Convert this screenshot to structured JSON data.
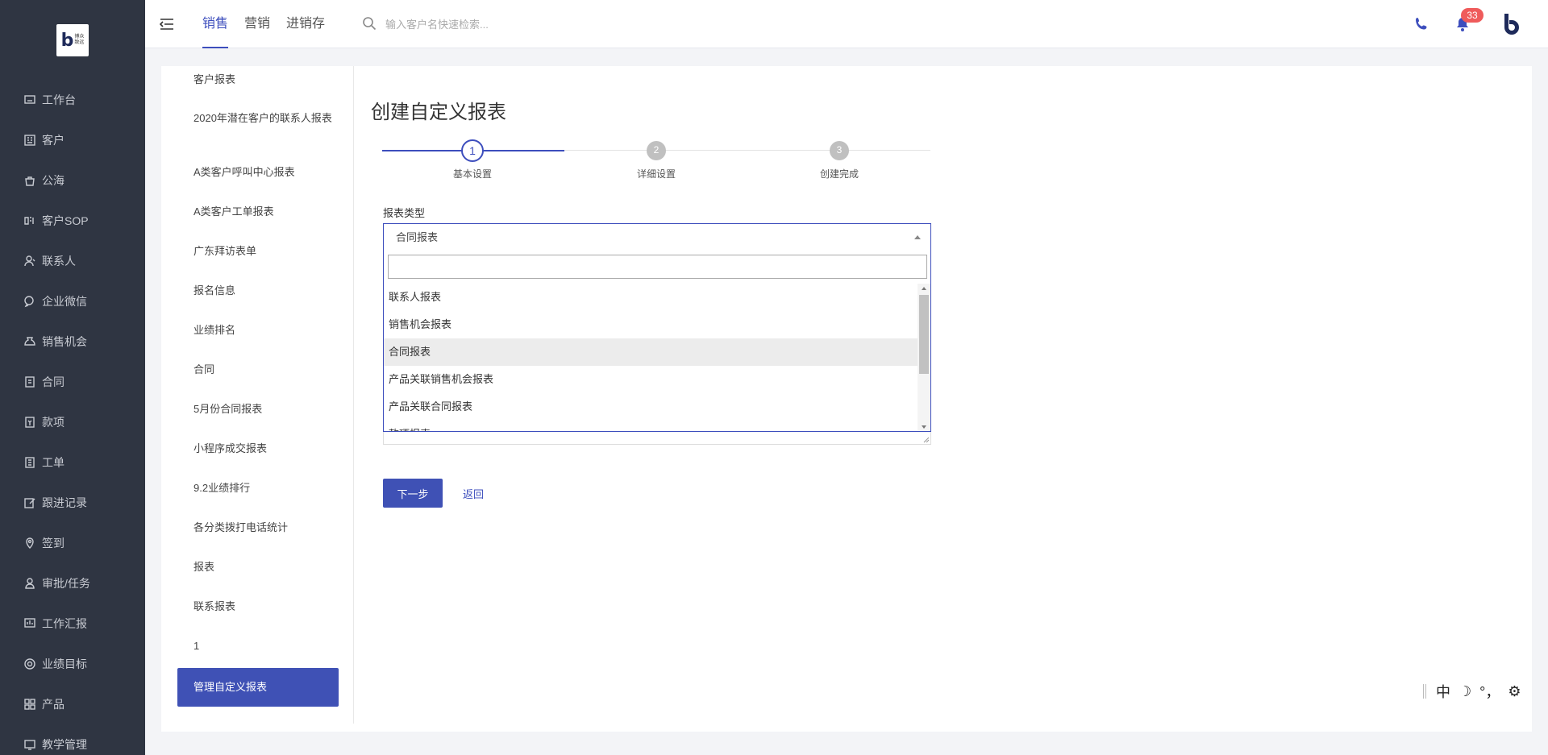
{
  "brand": {
    "logo_text": "b",
    "logo_sub": "博众\n致远"
  },
  "sidebar": {
    "items": [
      {
        "label": "工作台",
        "icon": "monitor-icon"
      },
      {
        "label": "客户",
        "icon": "building-icon"
      },
      {
        "label": "公海",
        "icon": "sea-icon"
      },
      {
        "label": "客户SOP",
        "icon": "sop-icon"
      },
      {
        "label": "联系人",
        "icon": "contact-icon"
      },
      {
        "label": "企业微信",
        "icon": "wechat-icon"
      },
      {
        "label": "销售机会",
        "icon": "money-bag-icon"
      },
      {
        "label": "合同",
        "icon": "contract-icon"
      },
      {
        "label": "款项",
        "icon": "payment-icon"
      },
      {
        "label": "工单",
        "icon": "ticket-icon"
      },
      {
        "label": "跟进记录",
        "icon": "edit-icon"
      },
      {
        "label": "签到",
        "icon": "location-icon"
      },
      {
        "label": "审批/任务",
        "icon": "approval-icon"
      },
      {
        "label": "工作汇报",
        "icon": "report-icon"
      },
      {
        "label": "业绩目标",
        "icon": "target-icon"
      },
      {
        "label": "产品",
        "icon": "grid-icon"
      },
      {
        "label": "教学管理",
        "icon": "teaching-icon"
      }
    ]
  },
  "topbar": {
    "tabs": [
      {
        "label": "销售",
        "active": true
      },
      {
        "label": "营销",
        "active": false
      },
      {
        "label": "进销存",
        "active": false
      }
    ],
    "search_placeholder": "输入客户名快速检索...",
    "notification_count": "33",
    "accent": "#3d4ebd"
  },
  "reports": {
    "items": [
      "客户报表",
      "2020年潜在客户的联系人报表",
      "A类客户呼叫中心报表",
      "A类客户工单报表",
      "广东拜访表单",
      "报名信息",
      "业绩排名",
      "合同",
      "5月份合同报表",
      "小程序成交报表",
      "9.2业绩排行",
      "各分类拨打电话统计",
      "报表",
      "联系报表",
      "1"
    ],
    "manage_label": "管理自定义报表"
  },
  "main": {
    "title": "创建自定义报表",
    "steps": [
      {
        "number": "1",
        "label": "基本设置",
        "state": "active"
      },
      {
        "number": "2",
        "label": "详细设置",
        "state": "pending"
      },
      {
        "number": "3",
        "label": "创建完成",
        "state": "pending"
      }
    ],
    "report_type_label": "报表类型",
    "report_type_value": "合同报表",
    "dropdown_search_value": "",
    "dropdown_options": [
      {
        "label": "联系人报表",
        "selected": false
      },
      {
        "label": "销售机会报表",
        "selected": false
      },
      {
        "label": "合同报表",
        "selected": true
      },
      {
        "label": "产品关联销售机会报表",
        "selected": false
      },
      {
        "label": "产品关联合同报表",
        "selected": false
      },
      {
        "label": "款项报表",
        "selected": false
      }
    ],
    "next_button": "下一步",
    "back_link": "返回"
  },
  "ime": {
    "mode": "中",
    "moon": "☽",
    "punct": "°，",
    "gear": "⚙"
  }
}
